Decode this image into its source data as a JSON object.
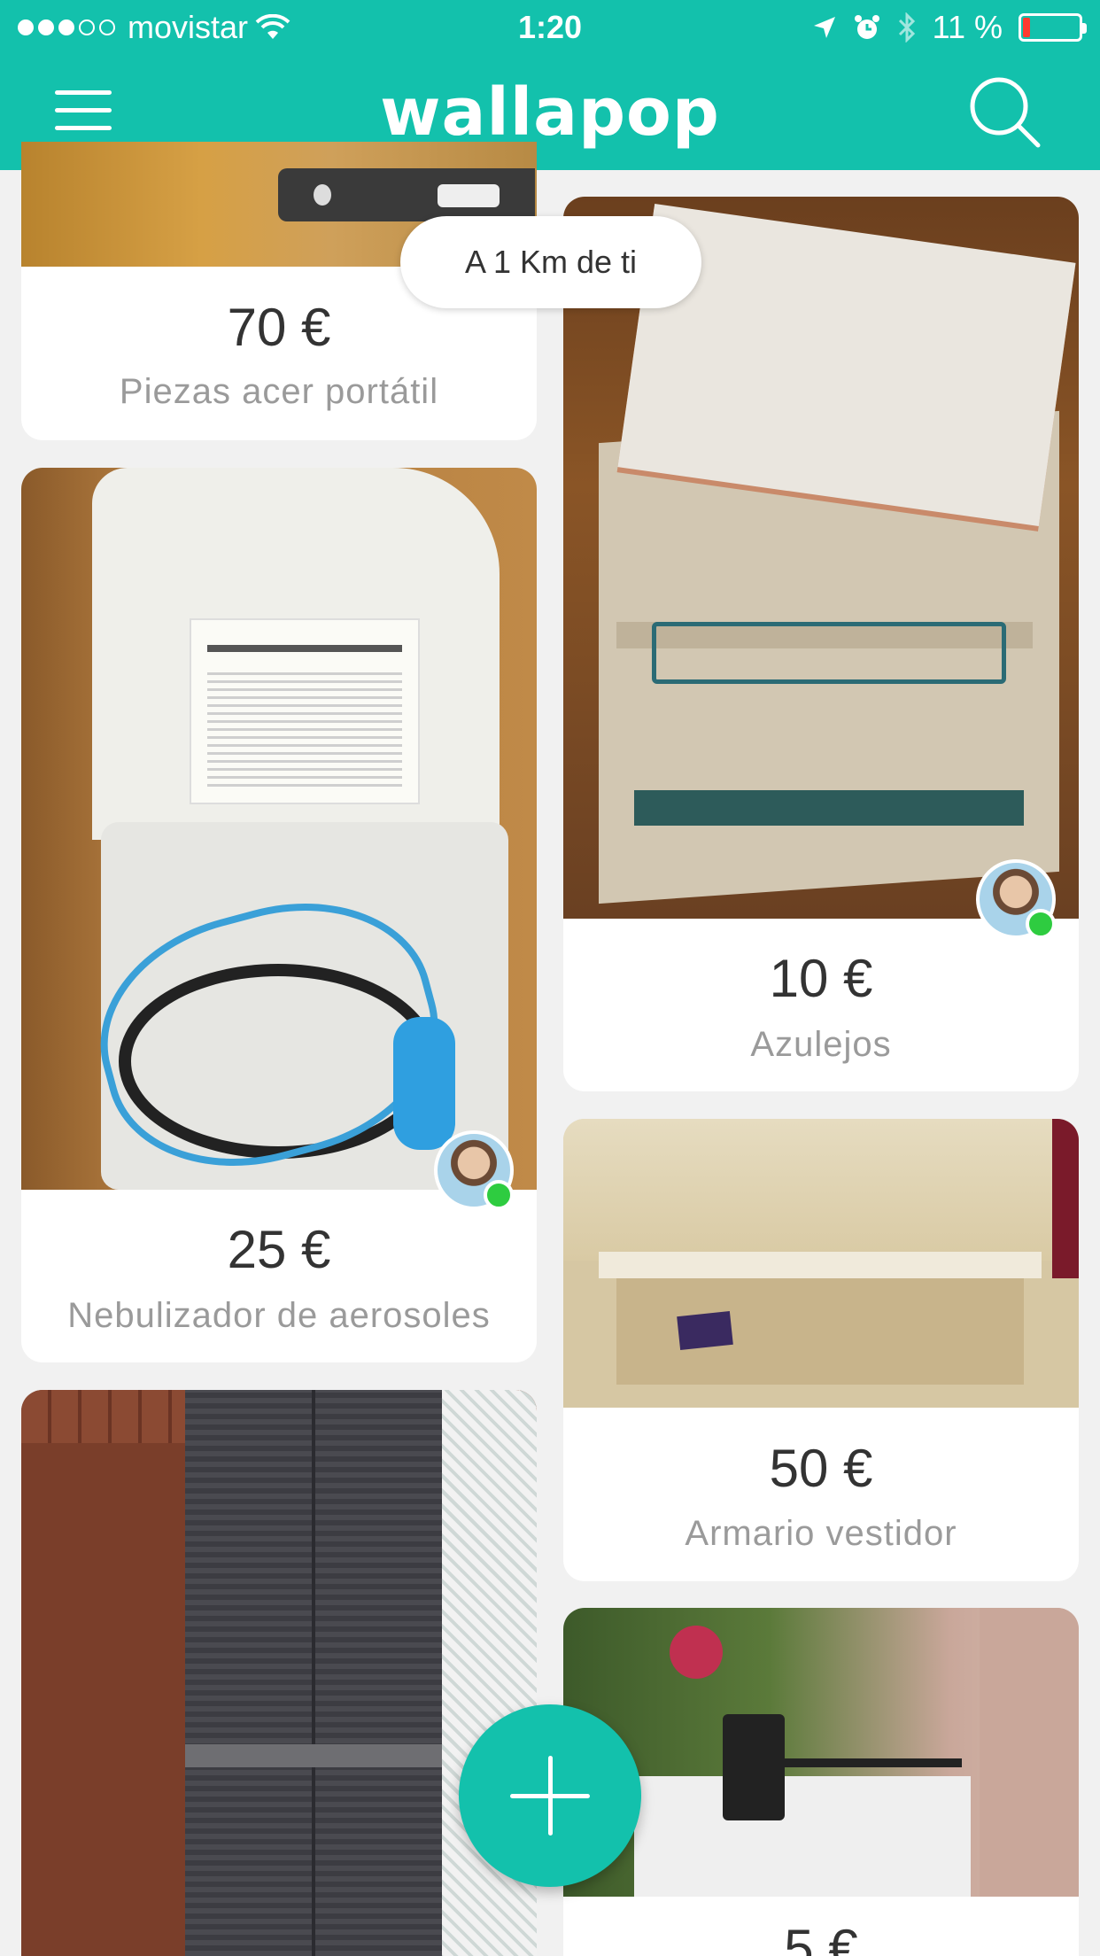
{
  "status_bar": {
    "carrier": "movistar",
    "time": "1:20",
    "battery": "11 %"
  },
  "nav": {
    "logo": "wallapop"
  },
  "distance_badge": "A 1 Km de ti",
  "products": [
    {
      "price": "70 €",
      "title": "Piezas acer portátil"
    },
    {
      "price": "25 €",
      "title": "Nebulizador de aerosoles"
    },
    {
      "price": "10 €",
      "title": "Azulejos"
    },
    {
      "price": "50 €",
      "title": "Armario vestidor"
    },
    {
      "price": "5 €",
      "title": ""
    }
  ],
  "colors": {
    "brand": "#13c1ac",
    "online": "#2ecc40"
  }
}
